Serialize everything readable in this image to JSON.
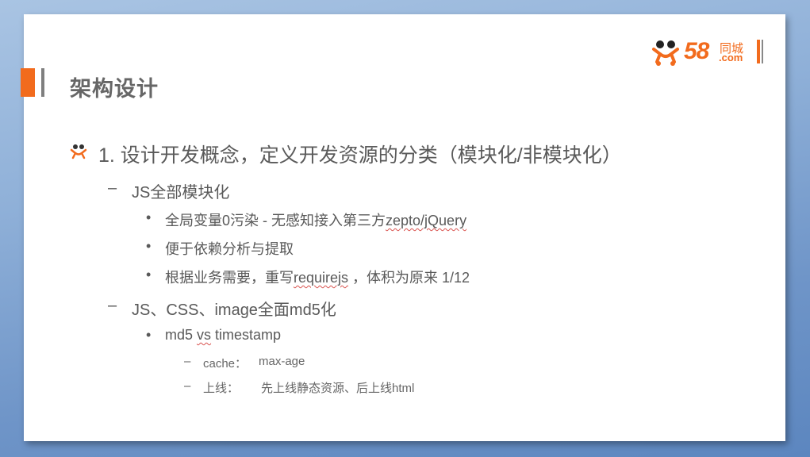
{
  "slide": {
    "title": "架构设计",
    "logo": {
      "number": "58",
      "chinese": "同城",
      "domain": ".com"
    },
    "heading": "1. 设计开发概念，定义开发资源的分类（模块化/非模块化）",
    "sections": [
      {
        "label": "JS全部模块化",
        "bullets": [
          {
            "pre": "全局变量0污染 - 无感知接入第三方",
            "marked": "zepto/jQuery",
            "post": ""
          },
          {
            "pre": "便于依赖分析与提取",
            "marked": "",
            "post": ""
          },
          {
            "pre": "根据业务需要，重写",
            "marked": "requirejs",
            "post": " ，体积为原来 1/12"
          }
        ]
      },
      {
        "label": "JS、CSS、image全面md5化",
        "bullets": [
          {
            "pre": "md5 ",
            "marked": "vs",
            "post": " timestamp"
          }
        ],
        "subitems": [
          {
            "key": "cache：",
            "value": "max-age"
          },
          {
            "key": "上线：",
            "value": "先上线静态资源、后上线html"
          }
        ]
      }
    ],
    "colors": {
      "accent": "#f26b1d",
      "text": "#595959",
      "background": "#ffffff"
    }
  }
}
